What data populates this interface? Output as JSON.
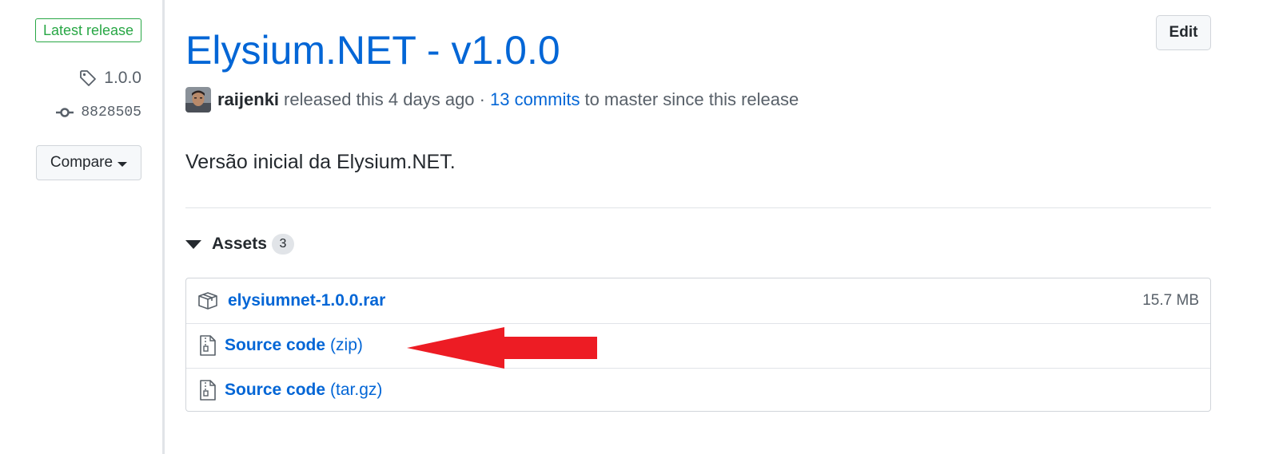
{
  "sidebar": {
    "latest_badge": "Latest release",
    "tag": "1.0.0",
    "commit": "8828505",
    "compare_label": "Compare"
  },
  "release": {
    "title": "Elysium.NET - v1.0.0",
    "edit_label": "Edit",
    "author": "raijenki",
    "released_text": "released this 4 days ago ·",
    "commits_link": "13 commits",
    "commits_suffix": "to master since this release",
    "description": "Versão inicial da Elysium.NET."
  },
  "assets": {
    "label": "Assets",
    "count": "3",
    "items": [
      {
        "name": "elysiumnet-1.0.0.rar",
        "size": "15.7 MB",
        "icon": "package-icon"
      },
      {
        "name": "Source code",
        "format": "(zip)",
        "icon": "file-zip-icon"
      },
      {
        "name": "Source code",
        "format": "(tar.gz)",
        "icon": "file-zip-icon"
      }
    ]
  },
  "colors": {
    "link": "#0366d6",
    "badge_green": "#28a745",
    "annotation_arrow": "#ed1c24"
  }
}
